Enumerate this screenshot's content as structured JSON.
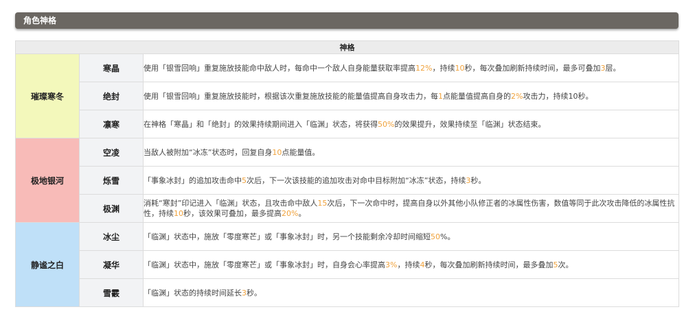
{
  "section": {
    "title": "角色神格"
  },
  "table": {
    "title": "神格",
    "groups": [
      {
        "name": "璀璨寒冬",
        "color": "#f3f8bb",
        "items": [
          {
            "name": "寒晶",
            "desc": [
              {
                "t": "使用「银雪回响」重复施放技能命中敌人时，每命中一个敌人自身能量获取率提高"
              },
              {
                "t": "12%",
                "hl": true
              },
              {
                "t": "，持续"
              },
              {
                "t": "10",
                "hl": true
              },
              {
                "t": "秒，每次叠加刷新持续时间，最多可叠加"
              },
              {
                "t": "3",
                "hl": true
              },
              {
                "t": "层。"
              }
            ]
          },
          {
            "name": "绝封",
            "desc": [
              {
                "t": "使用「银雪回响」重复施放技能时，根据该次重复施放技能的能量值提高自身攻击力，每"
              },
              {
                "t": "1",
                "hl": true
              },
              {
                "t": "点能量值提高自身的"
              },
              {
                "t": "2%",
                "hl": true
              },
              {
                "t": "攻击力，持续10秒。"
              }
            ]
          },
          {
            "name": "凛寒",
            "desc": [
              {
                "t": "在神格「寒晶」和「绝封」的效果持续期间进入「临渊」状态，将获得"
              },
              {
                "t": "50%",
                "hl": true
              },
              {
                "t": "的效果提升，效果持续至「临渊」状态结束。"
              }
            ]
          }
        ]
      },
      {
        "name": "极地银河",
        "color": "#f8bbb8",
        "items": [
          {
            "name": "空凌",
            "desc": [
              {
                "t": "当敌人被附加“冰冻”状态时，回复自身"
              },
              {
                "t": "10",
                "hl": true
              },
              {
                "t": "点能量值。"
              }
            ]
          },
          {
            "name": "烁雪",
            "desc": [
              {
                "t": "「事象冰封」的追加攻击命中"
              },
              {
                "t": "5",
                "hl": true
              },
              {
                "t": "次后，下一次该技能的追加攻击对命中目标附加“冰冻”状态，持续"
              },
              {
                "t": "3",
                "hl": true
              },
              {
                "t": "秒。"
              }
            ]
          },
          {
            "name": "极渊",
            "desc": [
              {
                "t": "消耗“寒封”印记进入「临渊」状态，且攻击命中敌人"
              },
              {
                "t": "15",
                "hl": true
              },
              {
                "t": "次后，下一次命中时，提高自身以外其他小队修正者的冰属性伤害，数值等同于此次攻击降低的冰属性抗性，持续"
              },
              {
                "t": "10",
                "hl": true
              },
              {
                "t": "秒，该效果可叠加，最多提高"
              },
              {
                "t": "20%",
                "hl": true
              },
              {
                "t": "。"
              }
            ]
          }
        ]
      },
      {
        "name": "静谧之白",
        "color": "#bfe0f8",
        "items": [
          {
            "name": "冰尘",
            "desc": [
              {
                "t": "「临渊」状态中，施放「零度寒芒」或「事象冰封」时，另一个技能剩余冷却时间缩短"
              },
              {
                "t": "50",
                "hl": true
              },
              {
                "t": "%。"
              }
            ]
          },
          {
            "name": "凝华",
            "desc": [
              {
                "t": "「临渊」状态中，施放「零度寒芒」或「事象冰封」时，自身会心率提高"
              },
              {
                "t": "3%",
                "hl": true
              },
              {
                "t": "，持续"
              },
              {
                "t": "4",
                "hl": true
              },
              {
                "t": "秒，每次叠加刷新持续时间，最多叠加"
              },
              {
                "t": "5",
                "hl": true
              },
              {
                "t": "次。"
              }
            ]
          },
          {
            "name": "雪霰",
            "desc": [
              {
                "t": "「临渊」状态的持续时间延长"
              },
              {
                "t": "3",
                "hl": true
              },
              {
                "t": "秒。"
              }
            ]
          }
        ]
      }
    ]
  }
}
